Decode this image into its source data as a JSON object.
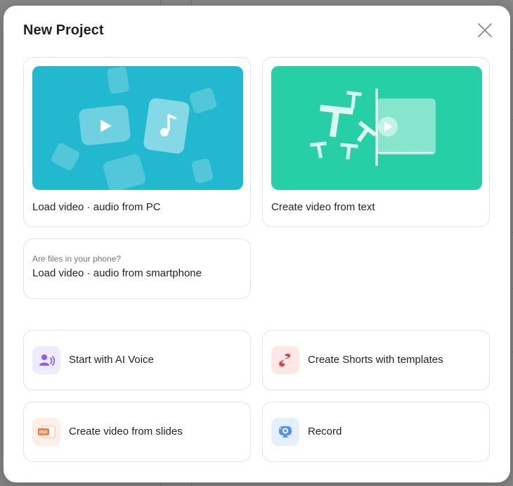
{
  "dialog": {
    "title": "New Project",
    "close_label": "Close"
  },
  "cards": {
    "load_pc": {
      "label": "Load video · audio from PC",
      "thumb_color": "#22b8d0"
    },
    "from_text": {
      "label": "Create video from text",
      "thumb_color": "#26cfa6"
    },
    "phone": {
      "hint": "Are files in your phone?",
      "label": "Load video · audio from smartphone"
    }
  },
  "actions": {
    "ai_voice": {
      "label": "Start with AI Voice",
      "icon": "ai-voice-icon",
      "bg": "#efeafc",
      "color": "#8b5cf6"
    },
    "shorts": {
      "label": "Create Shorts with templates",
      "icon": "shorts-icon",
      "bg": "#fde7e7",
      "color": "#ef3b3b"
    },
    "slides": {
      "label": "Create video from slides",
      "icon": "pdf-slides-icon",
      "bg": "#fdeee6",
      "color": "#f07d4a",
      "badge": "PDF"
    },
    "record": {
      "label": "Record",
      "icon": "webcam-icon",
      "bg": "#e5efff",
      "color": "#4f8ff7"
    }
  }
}
